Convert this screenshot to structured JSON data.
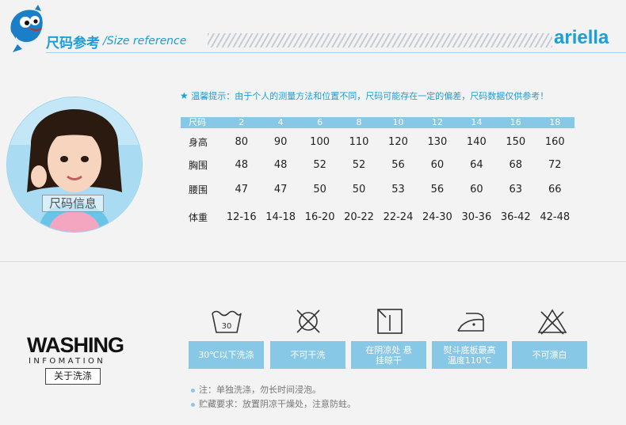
{
  "header": {
    "title_cn": "尺码参考",
    "title_en": "/Size reference",
    "brand": "ariella"
  },
  "photo": {
    "label": "尺码信息"
  },
  "tip": {
    "star": "★",
    "text": "温馨提示：由于个人的测量方法和位置不同，尺码可能存在一定的偏差，尺码数据仅供参考！"
  },
  "size_table": {
    "header": [
      "尺码",
      "2",
      "4",
      "6",
      "8",
      "10",
      "12",
      "14",
      "16",
      "18"
    ],
    "rows": [
      [
        "身高",
        "80",
        "90",
        "100",
        "110",
        "120",
        "130",
        "140",
        "150",
        "160"
      ],
      [
        "胸围",
        "48",
        "48",
        "52",
        "52",
        "56",
        "60",
        "64",
        "68",
        "72"
      ],
      [
        "腰围",
        "47",
        "47",
        "50",
        "50",
        "53",
        "56",
        "60",
        "63",
        "66"
      ],
      [
        "体重",
        "12-16",
        "14-18",
        "16-20",
        "20-22",
        "22-24",
        "24-30",
        "30-36",
        "36-42",
        "42-48"
      ]
    ]
  },
  "washing": {
    "title": "WASHING",
    "subtitle": "INFOMATION",
    "button": "关于洗涤",
    "icons": [
      {
        "name": "wash-30-icon",
        "number": "30",
        "label": "30℃以下洗涤"
      },
      {
        "name": "no-dry-clean-icon",
        "label": "不可干洗"
      },
      {
        "name": "hang-dry-shade-icon",
        "label": "在阴凉处 悬挂晾干"
      },
      {
        "name": "iron-low-icon",
        "label": "熨斗底板最高 温度110℃"
      },
      {
        "name": "no-bleach-icon",
        "label": "不可漂白"
      }
    ],
    "notes": [
      "注：单独洗涤，勿长时间浸泡。",
      "贮藏要求：放置阴凉干燥处，注意防蛀。"
    ]
  },
  "colors": {
    "accent": "#1a9fd9",
    "table_header": "#87c8e6",
    "background": "#f3f3f3"
  }
}
